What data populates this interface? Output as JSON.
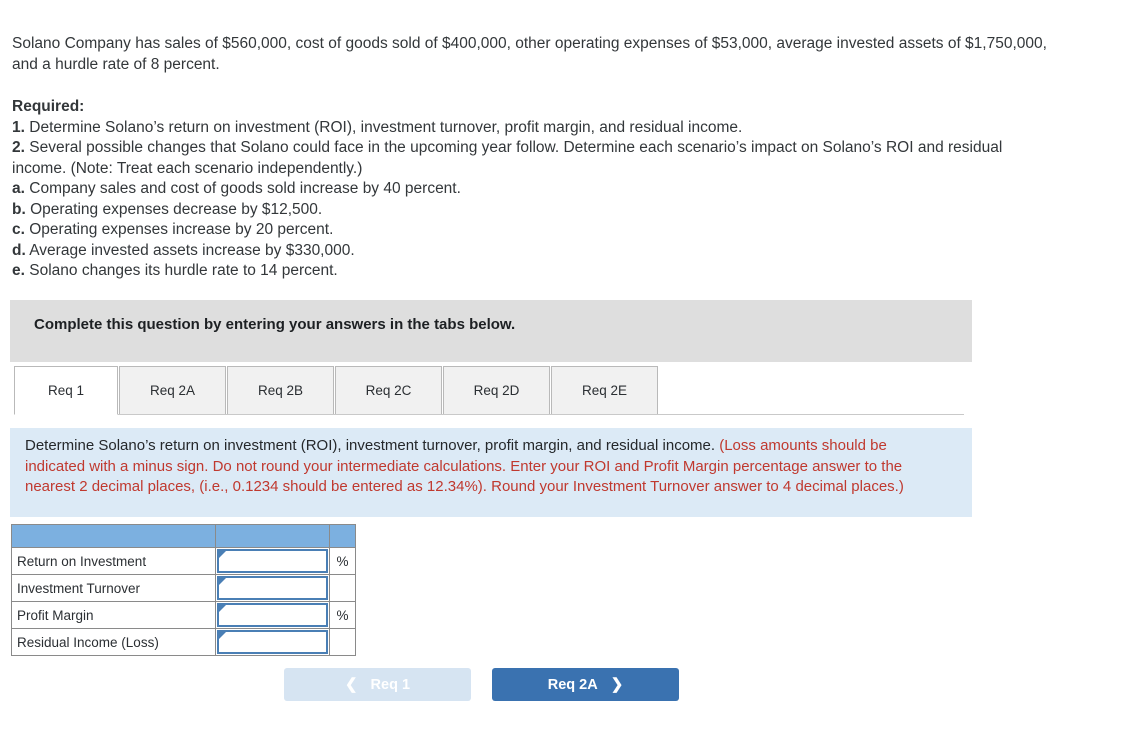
{
  "problem": {
    "statement_line1": "Solano Company has sales of $560,000, cost of goods sold of $400,000, other operating expenses of $53,000, average invested",
    "statement_line2": "assets of $1,750,000, and a hurdle rate of 8 percent."
  },
  "required": {
    "heading": "Required:",
    "items": [
      {
        "marker": "1.",
        "text": "Determine Solano’s return on investment (ROI), investment turnover, profit margin, and residual income."
      },
      {
        "marker": "2.",
        "text": "Several possible changes that Solano could face in the upcoming year follow. Determine each scenario’s impact on Solano’s ROI and residual income. (Note: Treat each scenario independently.)"
      },
      {
        "marker": "a.",
        "text": "Company sales and cost of goods sold increase by 40 percent."
      },
      {
        "marker": "b.",
        "text": "Operating expenses decrease by $12,500."
      },
      {
        "marker": "c.",
        "text": "Operating expenses increase by 20 percent."
      },
      {
        "marker": "d.",
        "text": "Average invested assets increase by $330,000."
      },
      {
        "marker": "e.",
        "text": "Solano changes its hurdle rate to 14 percent."
      }
    ]
  },
  "banner": {
    "text": "Complete this question by entering your answers in the tabs below."
  },
  "tabs": {
    "items": [
      {
        "label": "Req 1",
        "active": true
      },
      {
        "label": "Req 2A",
        "active": false
      },
      {
        "label": "Req 2B",
        "active": false
      },
      {
        "label": "Req 2C",
        "active": false
      },
      {
        "label": "Req 2D",
        "active": false
      },
      {
        "label": "Req 2E",
        "active": false
      }
    ]
  },
  "instruction": {
    "black_part": "Determine Solano’s return on investment (ROI), investment turnover, profit margin, and residual income.",
    "red_part": "(Loss amounts should be indicated with a minus sign. Do not round your intermediate calculations. Enter your ROI and Profit Margin percentage answer to the nearest 2 decimal places, (i.e., 0.1234 should be entered as 12.34%). Round your Investment Turnover answer to 4 decimal places.)"
  },
  "answer_table": {
    "header": {
      "label": "",
      "value": "",
      "unit": ""
    },
    "rows": [
      {
        "label": "Return on Investment",
        "value": "",
        "unit": "%"
      },
      {
        "label": "Investment Turnover",
        "value": "",
        "unit": ""
      },
      {
        "label": "Profit Margin",
        "value": "",
        "unit": "%"
      },
      {
        "label": "Residual Income (Loss)",
        "value": "",
        "unit": ""
      }
    ]
  },
  "nav": {
    "prev_label": "Req 1",
    "prev_icon": "chevron-left-icon",
    "prev_disabled": true,
    "next_label": "Req 2A",
    "next_icon": "chevron-right-icon"
  },
  "colors": {
    "banner_gray": "#dedede",
    "instruction_blue_bg": "#dceaf6",
    "instruction_red_text": "#c0392f",
    "table_header_blue": "#7cb0e0",
    "input_border_blue": "#4a7fb5",
    "button_active_blue": "#3a72b0",
    "button_disabled_blue": "#d6e4f2"
  }
}
